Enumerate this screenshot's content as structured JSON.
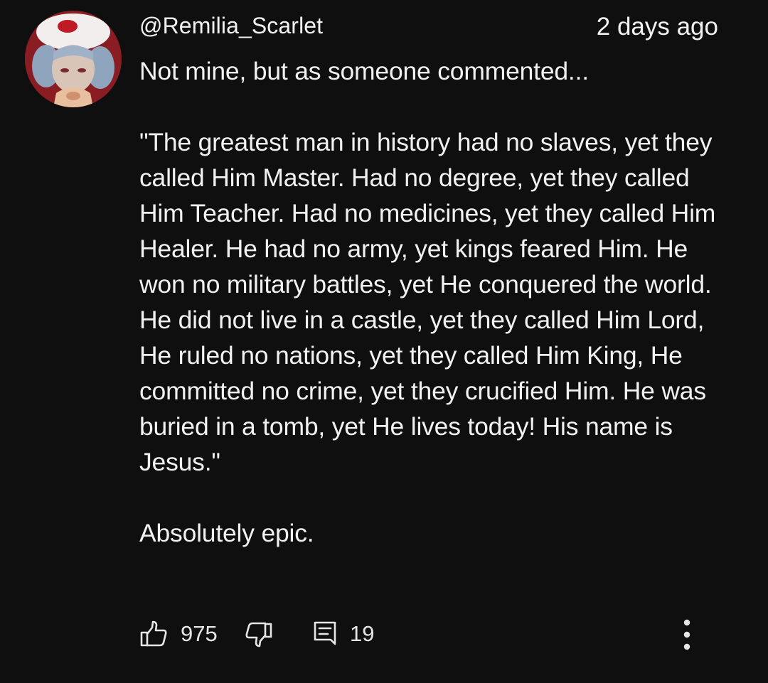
{
  "comment": {
    "author": "@Remilia_Scarlet",
    "timestamp": "2 days ago",
    "paragraphs": [
      "Not mine, but as someone commented...",
      " \"The greatest man in history had no slaves, yet they called Him Master. Had no degree, yet they called Him Teacher. Had no medicines, yet they called Him Healer. He had no army, yet kings feared Him. He won no military battles, yet He conquered the world. He did not live in a castle, yet they called Him Lord, He ruled no nations, yet they called Him King, He committed no crime, yet they crucified Him. He was buried in a tomb, yet He lives today! His name is Jesus.\"",
      "Absolutely epic."
    ],
    "likes": "975",
    "replies": "19"
  },
  "icons": {
    "like": "thumbs-up-icon",
    "dislike": "thumbs-down-icon",
    "reply": "comment-icon",
    "more": "more-vertical-icon"
  },
  "colors": {
    "background": "#0f0f0f",
    "text": "#f1f1f1",
    "icon": "#e6e6e6"
  }
}
